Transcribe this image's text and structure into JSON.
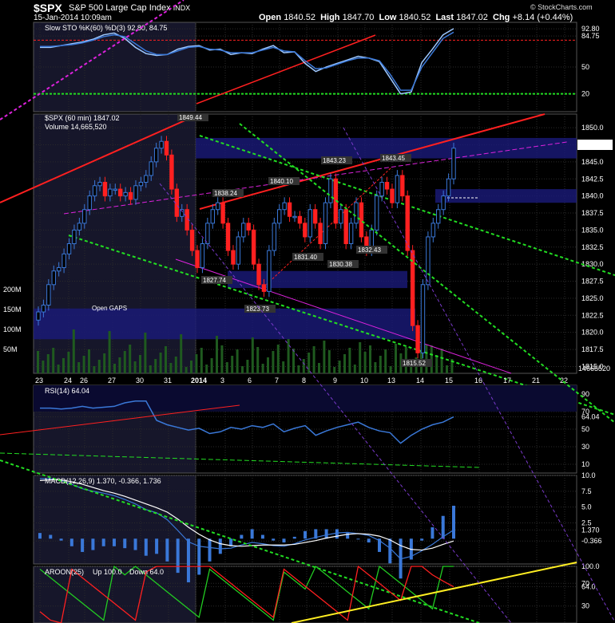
{
  "header": {
    "symbol": "$SPX",
    "name": "S&P 500 Large Cap Index",
    "exchange": "INDX",
    "datetime": "15-Jan-2014 10:09am",
    "open_label": "Open",
    "open": "1840.52",
    "high_label": "High",
    "high": "1847.70",
    "low_label": "Low",
    "low": "1840.52",
    "last_label": "Last",
    "last": "1847.02",
    "chg_label": "Chg",
    "chg": "+8.14 (+0.44%)",
    "brand": "© StockCharts.com"
  },
  "colors": {
    "up": "#3a78d8",
    "down": "#ff2020",
    "background": "#000000",
    "grid": "#2a2a2a",
    "band": "#1a1a7a"
  },
  "chart_data": [
    {
      "type": "line",
      "title": "Slow STO %K(60) %D(3)",
      "legend_values": "92.80, 84.75",
      "ylim": [
        0,
        100
      ],
      "y_ticks": [
        92.8,
        84.75,
        50,
        20
      ],
      "y_tick_labels": [
        "92.80",
        "84.75",
        "50",
        "20"
      ],
      "series": [
        {
          "name": "%K",
          "values": [
            72,
            72,
            74,
            76,
            78,
            81,
            86,
            88,
            82,
            72,
            65,
            63,
            64,
            70,
            73,
            74,
            69,
            70,
            64,
            66,
            65,
            70,
            74,
            66,
            67,
            54,
            45,
            50,
            54,
            58,
            62,
            60,
            56,
            38,
            20,
            22,
            55,
            70,
            86,
            93
          ]
        },
        {
          "name": "%D",
          "values": [
            73,
            73,
            74,
            75,
            77,
            80,
            84,
            86,
            84,
            76,
            68,
            64,
            64,
            68,
            72,
            73,
            70,
            69,
            66,
            66,
            66,
            69,
            72,
            68,
            67,
            57,
            48,
            49,
            53,
            57,
            60,
            60,
            57,
            42,
            24,
            24,
            50,
            66,
            82,
            89
          ]
        }
      ]
    },
    {
      "type": "candlestick",
      "title": "$SPX (60 min) 1847.02",
      "volume_label": "Volume 14,665,520",
      "ylim": [
        1814,
        1852
      ],
      "y_ticks": [
        1850,
        1847.5,
        1845,
        1842.5,
        1840,
        1837.5,
        1835,
        1832.5,
        1830,
        1827.5,
        1825,
        1822.5,
        1820,
        1817.5,
        1815
      ],
      "y_tick_labels": [
        "1850.0",
        "1847.5",
        "1845.0",
        "1842.5",
        "1840.0",
        "1837.5",
        "1835.0",
        "1832.5",
        "1830.0",
        "1827.5",
        "1825.0",
        "1822.5",
        "1820.0",
        "1817.5",
        "1815.0"
      ],
      "last_label": "1847.02",
      "volume_ticks": [
        "200M",
        "150M",
        "100M",
        "50M"
      ],
      "volume_last": "14665520",
      "x_tick_labels": [
        "23",
        "24",
        "26",
        "27",
        "30",
        "31",
        "2014",
        "3",
        "6",
        "7",
        "8",
        "9",
        "10",
        "13",
        "14",
        "15",
        "16",
        "17",
        "21",
        "22"
      ],
      "annotations": [
        "1849.44",
        "1838.24",
        "1840.10",
        "1843.23",
        "1843.45",
        "1831.40",
        "1830.38",
        "1832.43",
        "1827.74",
        "1823.73",
        "1815.52"
      ],
      "band_label": "Open GAPS",
      "closes": [
        1823,
        1824,
        1827,
        1829,
        1829.5,
        1831.5,
        1833,
        1835,
        1836,
        1838,
        1840,
        1841.5,
        1842,
        1840,
        1841,
        1841,
        1840,
        1840.5,
        1839.5,
        1841.5,
        1842,
        1843,
        1845,
        1847,
        1848,
        1846,
        1841,
        1837,
        1838,
        1835,
        1832,
        1829.5,
        1833,
        1836,
        1838,
        1839,
        1836,
        1832,
        1830,
        1834,
        1836,
        1835,
        1830,
        1827,
        1826,
        1832,
        1836,
        1838,
        1839,
        1837,
        1837,
        1836,
        1834,
        1838,
        1836,
        1833,
        1839,
        1842.5,
        1836,
        1838,
        1833,
        1836,
        1839,
        1834,
        1832,
        1835,
        1840,
        1842,
        1841,
        1839,
        1843,
        1840,
        1832,
        1821,
        1817,
        1827,
        1834,
        1836,
        1838,
        1840,
        1842.5,
        1847
      ]
    },
    {
      "type": "line",
      "title": "RSI(14) 64.04",
      "ylim": [
        0,
        100
      ],
      "y_ticks": [
        90,
        70,
        64.04,
        50,
        30,
        10
      ],
      "y_tick_labels": [
        "90",
        "70",
        "64.04",
        "50",
        "30",
        "10"
      ],
      "series": [
        {
          "name": "RSI(14)",
          "values": [
            74,
            74,
            73,
            74,
            76,
            74,
            75,
            76,
            80,
            82,
            82,
            60,
            55,
            52,
            49,
            51,
            45,
            47,
            52,
            50,
            54,
            52,
            56,
            47,
            51,
            54,
            43,
            48,
            52,
            55,
            58,
            52,
            48,
            46,
            34,
            43,
            50,
            55,
            58,
            64
          ]
        }
      ]
    },
    {
      "type": "line",
      "title": "MACD(12,26,9) 1.370, -0.366, 1.736",
      "ylim": [
        -4,
        10
      ],
      "y_ticks": [
        10,
        7.5,
        5,
        2.5,
        1.37,
        -0.366
      ],
      "y_tick_labels": [
        "10.0",
        "7.5",
        "5.0",
        "2.5",
        "1.370",
        "-0.366"
      ],
      "series": [
        {
          "name": "MACD",
          "values": [
            9.5,
            9.5,
            9.2,
            8.6,
            7.9,
            7.5,
            7.2,
            6.8,
            6.2,
            5.5,
            4.6,
            4.1,
            3.0,
            1.3,
            -0.5,
            -1.2,
            -1.4,
            -1.6,
            -1.5,
            -1.0,
            -0.6,
            -0.8,
            -1.1,
            -1.2,
            -0.8,
            -0.2,
            0.2,
            0.6,
            0.9,
            1.0,
            0.8,
            0.5,
            -0.3,
            -1.5,
            -3.2,
            -2.8,
            -1.9,
            -0.9,
            0.3,
            1.37
          ]
        },
        {
          "name": "Signal",
          "values": [
            9.2,
            9.3,
            9.3,
            9.0,
            8.6,
            8.1,
            7.6,
            7.2,
            6.7,
            6.1,
            5.5,
            4.9,
            4.2,
            3.1,
            1.8,
            0.7,
            -0.2,
            -0.8,
            -1.1,
            -1.2,
            -1.1,
            -1.0,
            -1.0,
            -1.0,
            -0.9,
            -0.6,
            -0.3,
            0.1,
            0.4,
            0.7,
            0.8,
            0.7,
            0.4,
            -0.2,
            -1.1,
            -1.7,
            -1.8,
            -1.5,
            -0.9,
            -0.366
          ]
        }
      ]
    },
    {
      "type": "line",
      "title": "AROON(25)",
      "legend_up": "Up 100.0",
      "legend_down": "Down 64.0",
      "ylim": [
        0,
        100
      ],
      "y_ticks": [
        100,
        70,
        64,
        30
      ],
      "y_tick_labels": [
        "100.0",
        "70",
        "64.0",
        "30"
      ],
      "series": [
        {
          "name": "Up",
          "color": "#22cc22",
          "values": [
            95,
            80,
            65,
            50,
            35,
            20,
            5,
            100,
            85,
            100,
            85,
            70,
            55,
            40,
            25,
            10,
            95,
            80,
            65,
            50,
            35,
            20,
            5,
            90,
            75,
            60,
            100,
            85,
            70,
            55,
            40,
            25,
            100,
            85,
            70,
            55,
            40,
            25,
            100,
            100
          ]
        },
        {
          "name": "Down",
          "color": "#ff2020",
          "values": [
            20,
            5,
            0,
            95,
            80,
            65,
            50,
            35,
            20,
            5,
            90,
            100,
            100,
            100,
            100,
            100,
            100,
            85,
            70,
            55,
            40,
            25,
            10,
            95,
            80,
            65,
            50,
            35,
            20,
            5,
            100,
            85,
            70,
            55,
            40,
            100,
            100,
            85,
            74,
            64
          ]
        }
      ]
    }
  ]
}
